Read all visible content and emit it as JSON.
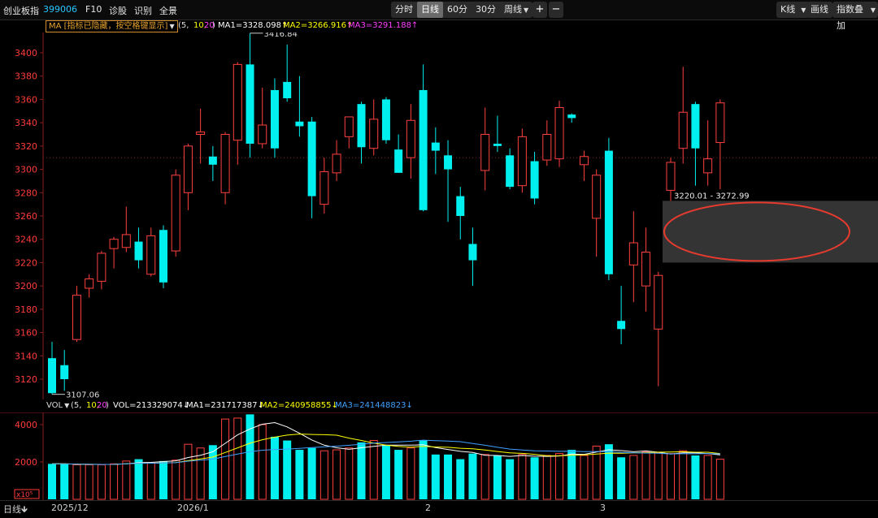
{
  "toolbar": {
    "index_name": "创业板指",
    "index_code": "399006",
    "f10": "F10",
    "diagnose": "诊股",
    "recognize": "识别",
    "full_view": "全景",
    "periods": [
      "分时",
      "日线",
      "60分",
      "30分",
      "周线"
    ],
    "active_period": "日线",
    "zoom_in": "+",
    "zoom_out": "−",
    "chart_mode": "K线",
    "draw_line": "画线",
    "overlay": "指数叠加"
  },
  "ma_legend": {
    "dropdown": "MA [指标已隐藏，按空格键显示]",
    "params_open": "(5,",
    "p10": "10,",
    "p20": "20",
    "params_close": ")",
    "ma1": "MA1=3328.098↑",
    "ma2": "MA2=3266.916↑",
    "ma3": "MA3=3291.188↑"
  },
  "vol_legend": {
    "dropdown": "VOL",
    "params_open": "(5,",
    "p10": "10,",
    "p20": "20",
    "params_close": ")",
    "vol": "VOL=213329074↓",
    "ma1": "MA1=231717387↓",
    "ma2": "MA2=240958855↓",
    "ma3": "MA3=241448823↓"
  },
  "annotations": {
    "high": "3416.84",
    "low": "3107.06",
    "range": "3220.01 - 3272.99",
    "vol_unit": "x10⁵"
  },
  "date_bar": {
    "period_label": "日线",
    "dates": [
      "2025/12",
      "2026/1",
      "2",
      "3"
    ]
  },
  "colors": {
    "up": "#ff4040",
    "down": "#00f0f0",
    "ma1": "#ffffff",
    "ma2": "#ffff00",
    "ma3": "#ff40ff",
    "vol_ma3": "#40a0ff",
    "highlight_ellipse": "#e53b2e"
  },
  "chart_data": {
    "type": "candlestick",
    "ylim": [
      3100,
      3420
    ],
    "yticks": [
      3120,
      3140,
      3160,
      3180,
      3200,
      3220,
      3240,
      3260,
      3280,
      3300,
      3320,
      3340,
      3360,
      3380,
      3400
    ],
    "vol_yticks": [
      2000,
      4000
    ],
    "vol_ylim": [
      0,
      4600
    ],
    "candles": [
      {
        "o": 3138,
        "h": 3152,
        "l": 3107,
        "c": 3108
      },
      {
        "o": 3132,
        "h": 3145,
        "l": 3110,
        "c": 3120
      },
      {
        "o": 3154,
        "h": 3200,
        "l": 3152,
        "c": 3192
      },
      {
        "o": 3198,
        "h": 3210,
        "l": 3190,
        "c": 3206
      },
      {
        "o": 3204,
        "h": 3230,
        "l": 3197,
        "c": 3228
      },
      {
        "o": 3232,
        "h": 3242,
        "l": 3215,
        "c": 3240
      },
      {
        "o": 3233,
        "h": 3268,
        "l": 3229,
        "c": 3244
      },
      {
        "o": 3238,
        "h": 3250,
        "l": 3215,
        "c": 3222
      },
      {
        "o": 3210,
        "h": 3250,
        "l": 3208,
        "c": 3243
      },
      {
        "o": 3248,
        "h": 3252,
        "l": 3198,
        "c": 3203
      },
      {
        "o": 3230,
        "h": 3300,
        "l": 3225,
        "c": 3295
      },
      {
        "o": 3280,
        "h": 3322,
        "l": 3265,
        "c": 3320
      },
      {
        "o": 3330,
        "h": 3352,
        "l": 3305,
        "c": 3332
      },
      {
        "o": 3311,
        "h": 3320,
        "l": 3290,
        "c": 3304
      },
      {
        "o": 3280,
        "h": 3332,
        "l": 3270,
        "c": 3330
      },
      {
        "o": 3325,
        "h": 3392,
        "l": 3304,
        "c": 3390
      },
      {
        "o": 3390,
        "h": 3416.84,
        "l": 3310,
        "c": 3322
      },
      {
        "o": 3322,
        "h": 3370,
        "l": 3318,
        "c": 3338
      },
      {
        "o": 3368,
        "h": 3378,
        "l": 3310,
        "c": 3318
      },
      {
        "o": 3375,
        "h": 3407,
        "l": 3358,
        "c": 3361
      },
      {
        "o": 3341,
        "h": 3380,
        "l": 3328,
        "c": 3337
      },
      {
        "o": 3341,
        "h": 3345,
        "l": 3258,
        "c": 3277
      },
      {
        "o": 3270,
        "h": 3310,
        "l": 3262,
        "c": 3298
      },
      {
        "o": 3297,
        "h": 3325,
        "l": 3290,
        "c": 3313
      },
      {
        "o": 3328,
        "h": 3345,
        "l": 3318,
        "c": 3345
      },
      {
        "o": 3356,
        "h": 3358,
        "l": 3305,
        "c": 3319
      },
      {
        "o": 3318,
        "h": 3360,
        "l": 3312,
        "c": 3343
      },
      {
        "o": 3360,
        "h": 3362,
        "l": 3322,
        "c": 3325
      },
      {
        "o": 3317,
        "h": 3330,
        "l": 3300,
        "c": 3297
      },
      {
        "o": 3310,
        "h": 3356,
        "l": 3292,
        "c": 3342
      },
      {
        "o": 3368,
        "h": 3390,
        "l": 3264,
        "c": 3265
      },
      {
        "o": 3323,
        "h": 3336,
        "l": 3296,
        "c": 3316
      },
      {
        "o": 3312,
        "h": 3325,
        "l": 3255,
        "c": 3300
      },
      {
        "o": 3277,
        "h": 3285,
        "l": 3240,
        "c": 3260
      },
      {
        "o": 3236,
        "h": 3250,
        "l": 3200,
        "c": 3222
      },
      {
        "o": 3299,
        "h": 3353,
        "l": 3282,
        "c": 3330
      },
      {
        "o": 3322,
        "h": 3346,
        "l": 3315,
        "c": 3320
      },
      {
        "o": 3312,
        "h": 3318,
        "l": 3283,
        "c": 3285
      },
      {
        "o": 3286,
        "h": 3335,
        "l": 3280,
        "c": 3328
      },
      {
        "o": 3307,
        "h": 3315,
        "l": 3270,
        "c": 3275
      },
      {
        "o": 3308,
        "h": 3342,
        "l": 3303,
        "c": 3330
      },
      {
        "o": 3309,
        "h": 3359,
        "l": 3302,
        "c": 3353
      },
      {
        "o": 3347,
        "h": 3348,
        "l": 3340,
        "c": 3344
      },
      {
        "o": 3304,
        "h": 3316,
        "l": 3290,
        "c": 3311
      },
      {
        "o": 3258,
        "h": 3300,
        "l": 3225,
        "c": 3295
      },
      {
        "o": 3316,
        "h": 3327,
        "l": 3205,
        "c": 3210
      },
      {
        "o": 3170,
        "h": 3200,
        "l": 3150,
        "c": 3163
      },
      {
        "o": 3218,
        "h": 3264,
        "l": 3186,
        "c": 3237
      },
      {
        "o": 3200,
        "h": 3250,
        "l": 3178,
        "c": 3229
      },
      {
        "o": 3163,
        "h": 3212,
        "l": 3114,
        "c": 3209
      },
      {
        "o": 3282,
        "h": 3310,
        "l": 3272.99,
        "c": 3306
      },
      {
        "o": 3318,
        "h": 3388,
        "l": 3305,
        "c": 3349
      },
      {
        "o": 3356,
        "h": 3358,
        "l": 3286,
        "c": 3318
      },
      {
        "o": 3297,
        "h": 3342,
        "l": 3286,
        "c": 3309
      },
      {
        "o": 3323,
        "h": 3360,
        "l": 3283,
        "c": 3357
      }
    ],
    "volumes": [
      1900,
      1900,
      1850,
      1850,
      1850,
      1900,
      2050,
      2150,
      1950,
      2050,
      2100,
      2950,
      2750,
      2900,
      4300,
      4350,
      4550,
      4000,
      3350,
      3150,
      2650,
      2750,
      2600,
      2650,
      2750,
      3050,
      3150,
      2900,
      2650,
      2750,
      3150,
      2400,
      2400,
      2150,
      2450,
      2400,
      2350,
      2150,
      2400,
      2250,
      2350,
      2450,
      2650,
      2350,
      2850,
      2950,
      2250,
      2350,
      2550,
      2500,
      2450,
      2600,
      2350,
      2350,
      2150
    ],
    "range_label": "3220.01 - 3272.99"
  }
}
